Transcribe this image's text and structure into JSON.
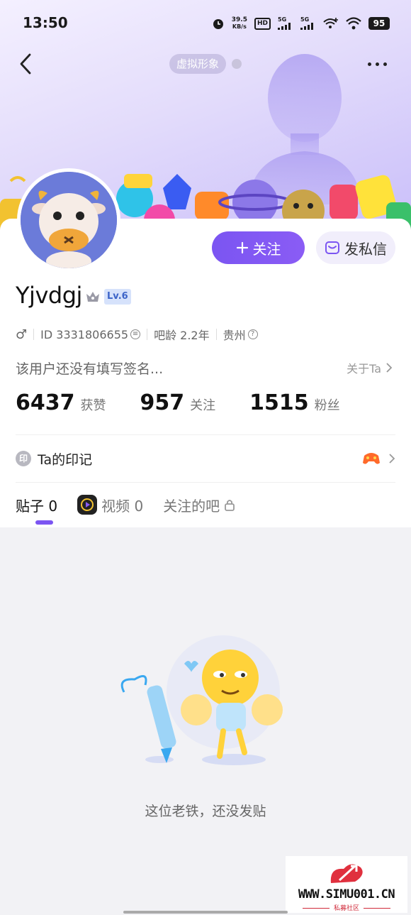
{
  "status_bar": {
    "time": "13:50",
    "net_speed_value": "39.5",
    "net_speed_unit": "KB/s",
    "hd_label": "HD",
    "sim1_label": "5G",
    "sim2_label": "5G",
    "battery": "95"
  },
  "header": {
    "avatar_tag": "虚拟形象"
  },
  "profile": {
    "username": "Yjvdgj",
    "level": "Lv.6",
    "gender_symbol": "♂",
    "id_text": "ID 3331806655",
    "bar_age": "吧龄 2.2年",
    "location": "贵州",
    "bio": "该用户还没有填写签名...",
    "about_label": "关于Ta"
  },
  "actions": {
    "follow_label": "关注",
    "message_label": "发私信"
  },
  "stats": [
    {
      "value": "6437",
      "label": "获赞"
    },
    {
      "value": "957",
      "label": "关注"
    },
    {
      "value": "1515",
      "label": "粉丝"
    }
  ],
  "mark": {
    "icon_text": "印",
    "label": "Ta的印记"
  },
  "tabs": [
    {
      "label": "贴子 0"
    },
    {
      "label": "视频 0"
    },
    {
      "label": "关注的吧"
    }
  ],
  "empty_state": {
    "message": "这位老铁，还没发贴"
  },
  "watermark": {
    "site": "WWW.SIMU001.CN",
    "subtitle": "私募社区"
  },
  "colors": {
    "accent": "#7b55f2",
    "level_bg": "#d6e2fb",
    "level_text": "#3c64c8"
  }
}
